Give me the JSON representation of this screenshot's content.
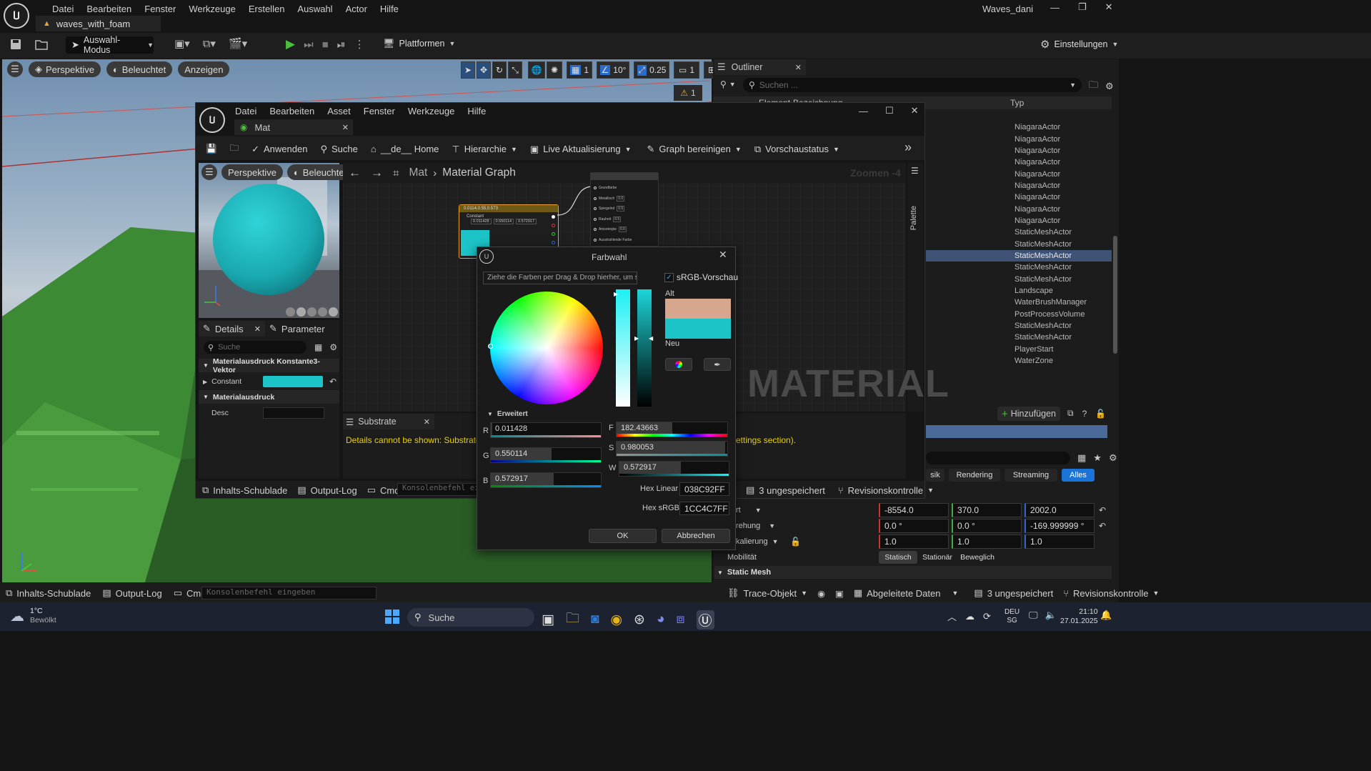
{
  "app": {
    "menu": [
      "Datei",
      "Bearbeiten",
      "Fenster",
      "Werkzeuge",
      "Erstellen",
      "Auswahl",
      "Actor",
      "Hilfe"
    ],
    "project_name": "Waves_dani",
    "level_tab": "waves_with_foam",
    "mode_label": "Auswahl-Modus",
    "platforms_label": "Plattformen",
    "settings_label": "Einstellungen"
  },
  "viewport": {
    "perspective": "Perspektive",
    "lit": "Beleuchtet",
    "show": "Anzeigen",
    "grid_value": "1",
    "angle_value": "10°",
    "scale_value": "0.25",
    "camera_value": "1",
    "warning_count": "1"
  },
  "outliner": {
    "title": "Outliner",
    "search_placeholder": "Suchen ...",
    "col_label": "Element-Bezeichnung",
    "col_type": "Typ",
    "types": [
      "NiagaraActor",
      "NiagaraActor",
      "NiagaraActor",
      "NiagaraActor",
      "NiagaraActor",
      "NiagaraActor",
      "NiagaraActor",
      "NiagaraActor",
      "NiagaraActor",
      "StaticMeshActor",
      "StaticMeshActor",
      "StaticMeshActor",
      "StaticMeshActor",
      "StaticMeshActor",
      "Landscape",
      "WaterBrushManager",
      "PostProcessVolume",
      "StaticMeshActor",
      "StaticMeshActor",
      "PlayerStart",
      "WaterZone"
    ],
    "selected_index": 11
  },
  "details_main": {
    "add_label": "Hinzufügen",
    "filter_tabs": [
      "sik",
      "Rendering",
      "Streaming",
      "Alles"
    ],
    "active_filter": "Alles",
    "location_label": "rt",
    "rotation_label": "rehung",
    "scale_label": "kalierung",
    "location": [
      "-8554.0",
      "370.0",
      "2002.0"
    ],
    "rotation": [
      "0.0 °",
      "0.0 °",
      "-169.999999 °"
    ],
    "scale": [
      "1.0",
      "1.0",
      "1.0"
    ],
    "mobility_label": "Mobilität",
    "mobility_options": [
      "Statisch",
      "Stationär",
      "Beweglich"
    ],
    "static_mesh_section": "Static Mesh"
  },
  "material_editor": {
    "menu": [
      "Datei",
      "Bearbeiten",
      "Asset",
      "Fenster",
      "Werkzeuge",
      "Hilfe"
    ],
    "tab_title": "Mat",
    "toolbar": {
      "apply": "Anwenden",
      "search": "Suche",
      "home": "__de__ Home",
      "hierarchy": "Hierarchie",
      "live_update": "Live Aktualisierung",
      "clean_graph": "Graph bereinigen",
      "preview_state": "Vorschaustatus"
    },
    "preview": {
      "perspective": "Perspektive",
      "lit": "Beleuchtet"
    },
    "breadcrumb": {
      "root": "Mat",
      "current": "Material Graph"
    },
    "zoom_label": "Zoomen -4",
    "palette_label": "Palette",
    "watermark": "MATERIAL",
    "node": {
      "title": "0.0114,0.55,0.573",
      "label": "Constant",
      "values": [
        "0.011428",
        "0.550114",
        "0.572917"
      ]
    },
    "result_node_pins": [
      {
        "label": "Grundfarbe",
        "value": ""
      },
      {
        "label": "Metallisch",
        "value": "0.0"
      },
      {
        "label": "Spiegelnd",
        "value": "0.5"
      },
      {
        "label": "Rauheit",
        "value": "0.5"
      },
      {
        "label": "Anisotropie",
        "value": "0.0"
      },
      {
        "label": "Ausstrahlende Farbe",
        "value": ""
      }
    ],
    "details": {
      "tab_details": "Details",
      "tab_params": "Parameter",
      "search_placeholder": "Suche",
      "section_vector": "Materialausdruck Konstante3-Vektor",
      "constant_label": "Constant",
      "section_expr": "Materialausdruck",
      "desc_label": "Desc"
    },
    "substrate": {
      "title": "Substrate",
      "message_left": "Details cannot be shown: Substrate (Be",
      "message_right": "ettings section)."
    },
    "bottom": {
      "content_drawer": "Inhalts-Schublade",
      "output_log": "Output-Log",
      "cmd": "Cmd",
      "console_placeholder": "Konsolenbefehl ein",
      "unsaved": "3 ungespeichert",
      "revision": "Revisionskontrolle"
    }
  },
  "color_picker": {
    "title": "Farbwahl",
    "drop_hint": "Ziehe die Farben per Drag & Drop hierher, um sie zu speichern",
    "srgb_preview": "sRGB-Vorschau",
    "old_label": "Alt",
    "new_label": "Neu",
    "advanced": "Erweitert",
    "r_label": "R",
    "r_value": "0.011428",
    "g_label": "G",
    "g_value": "0.550114",
    "b_label": "B",
    "b_value": "0.572917",
    "h_label": "F",
    "h_value": "182.43663",
    "s_label": "S",
    "s_value": "0.980053",
    "v_label": "W",
    "v_value": "0.572917",
    "hex_linear_label": "Hex Linear",
    "hex_linear": "038C92FF",
    "hex_srgb_label": "Hex sRGB",
    "hex_srgb": "1CC4C7FF",
    "ok": "OK",
    "cancel": "Abbrechen",
    "old_color": "#d6a68e",
    "new_color": "#1cc4c7"
  },
  "main_bottom": {
    "content_drawer": "Inhalts-Schublade",
    "output_log": "Output-Log",
    "cmd": "Cmd",
    "console_placeholder": "Konsolenbefehl eingeben",
    "trace": "Trace-Objekt",
    "derived_data": "Abgeleitete Daten",
    "unsaved": "3 ungespeichert",
    "revision": "Revisionskontrolle"
  },
  "taskbar": {
    "weather_temp": "1°C",
    "weather_desc": "Bewölkt",
    "search_placeholder": "Suche",
    "lang_top": "DEU",
    "lang_bottom": "SG",
    "time": "21:10",
    "date": "27.01.2025"
  }
}
